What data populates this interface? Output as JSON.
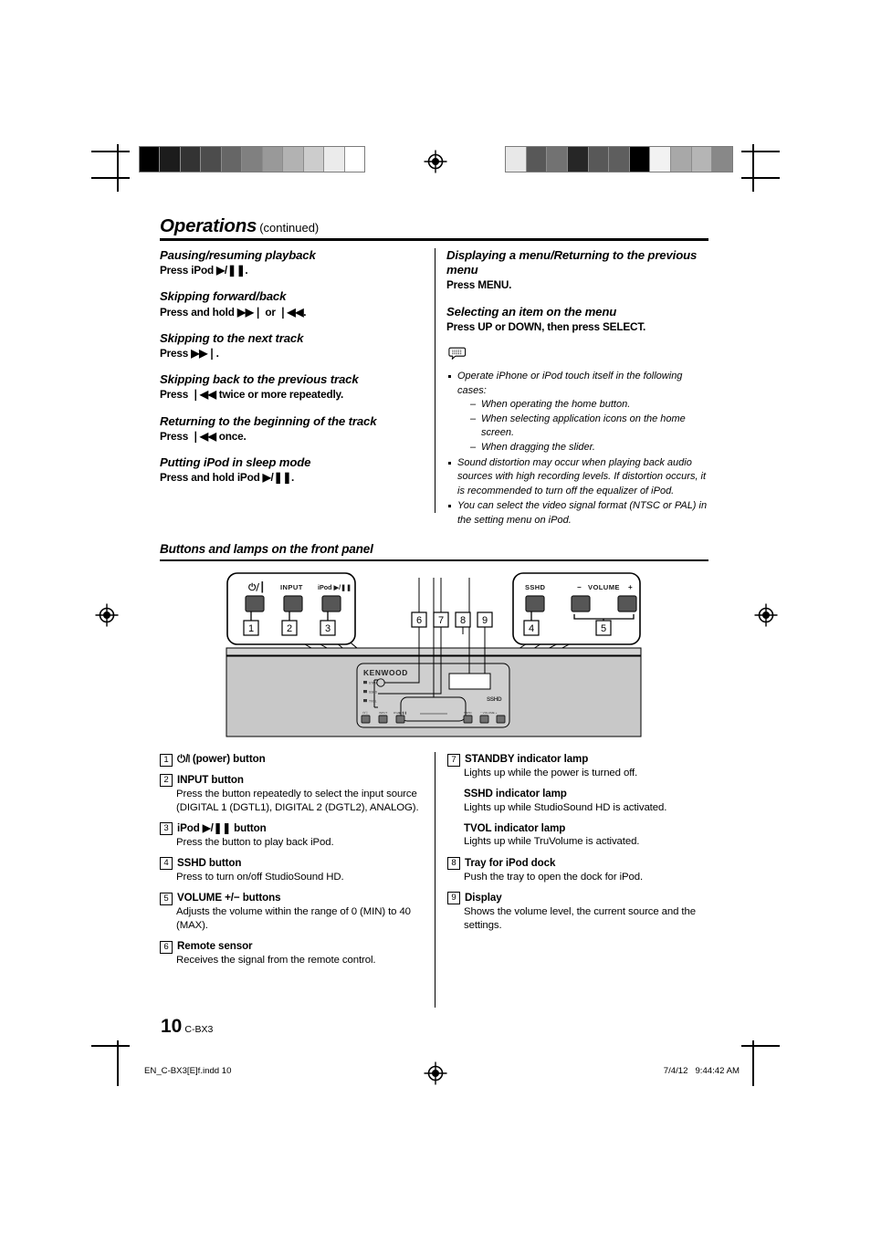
{
  "header": {
    "title": "Operations",
    "continued": "(continued)"
  },
  "left_column": [
    {
      "heading": "Pausing/resuming playback",
      "body": "Press iPod ▶/❚❚."
    },
    {
      "heading": "Skipping forward/back",
      "body": "Press and hold ▶▶❘ or ❘◀◀."
    },
    {
      "heading": "Skipping to the next track",
      "body": "Press ▶▶❘."
    },
    {
      "heading": "Skipping back to the previous track",
      "body": "Press ❘◀◀ twice or more repeatedly."
    },
    {
      "heading": "Returning to the beginning of the track",
      "body": "Press ❘◀◀ once."
    },
    {
      "heading": "Putting iPod in sleep mode",
      "body": "Press and hold iPod ▶/❚❚."
    }
  ],
  "right_column": [
    {
      "heading": "Displaying a menu/Returning to the previous menu",
      "body": "Press MENU."
    },
    {
      "heading": "Selecting an item on the menu",
      "body": "Press UP or DOWN, then press SELECT."
    }
  ],
  "notes": {
    "icon": "note-bubble-icon",
    "items": [
      {
        "text": "Operate iPhone or iPod touch itself in the following cases:",
        "subitems": [
          "When operating the home button.",
          "When selecting application icons on the home screen.",
          "When dragging the slider."
        ]
      },
      {
        "text": "Sound distortion may occur when playing back audio sources with high recording levels. If distortion occurs, it is recommended to turn off the equalizer of iPod.",
        "subitems": []
      },
      {
        "text": "You can select the video signal format (NTSC or PAL) in the setting menu on iPod.",
        "subitems": []
      }
    ]
  },
  "section2": {
    "title": "Buttons and lamps on the front panel"
  },
  "figure": {
    "brand": "KENWOOD",
    "left_callout": {
      "buttons": [
        {
          "label": "⏻/❘",
          "number": "1"
        },
        {
          "label": "INPUT",
          "number": "2"
        },
        {
          "label": "iPod ▶/❚❚",
          "number": "3"
        }
      ]
    },
    "right_callout": {
      "sshd_label": "SSHD",
      "sshd_number": "4",
      "volume_minus": "−",
      "volume_label": "VOLUME",
      "volume_plus": "+",
      "volume_number": "5"
    },
    "center_numbers": [
      "6",
      "7",
      "8",
      "9"
    ],
    "sshd_logo": "SSHD"
  },
  "descriptions_left": [
    {
      "number": "1",
      "title": "⏻/❘ (power) button",
      "body": ""
    },
    {
      "number": "2",
      "title": "INPUT button",
      "body": "Press the button repeatedly to select the input source (DIGITAL 1 (DGTL1), DIGITAL 2 (DGTL2), ANALOG)."
    },
    {
      "number": "3",
      "title": "iPod ▶/❚❚ button",
      "body": "Press the button to play back iPod."
    },
    {
      "number": "4",
      "title": "SSHD button",
      "body": "Press to turn on/off StudioSound HD."
    },
    {
      "number": "5",
      "title": "VOLUME +/− buttons",
      "body": "Adjusts the volume within the range of 0 (MIN) to 40 (MAX)."
    },
    {
      "number": "6",
      "title": "Remote sensor",
      "body": "Receives the signal from the remote control."
    }
  ],
  "descriptions_right": [
    {
      "number": "7",
      "title": "STANDBY indicator lamp",
      "body": "Lights up while the power is turned off.",
      "sublamps": [
        {
          "title": "SSHD indicator lamp",
          "body": "Lights up while StudioSound HD is activated."
        },
        {
          "title": "TVOL indicator lamp",
          "body": "Lights up while TruVolume is activated."
        }
      ]
    },
    {
      "number": "8",
      "title": "Tray for iPod dock",
      "body": "Push the tray to open the dock for iPod.",
      "sublamps": []
    },
    {
      "number": "9",
      "title": "Display",
      "body": "Shows the volume level, the current source and the settings.",
      "sublamps": []
    }
  ],
  "page": {
    "number": "10",
    "model": "C-BX3"
  },
  "footer": {
    "filename": "EN_C-BX3[E]f.indd   10",
    "timestamp": "7/4/12   9:44:42 AM"
  },
  "calibration": {
    "left_strip": [
      "#000000",
      "#1c1c1c",
      "#333333",
      "#4c4c4c",
      "#666666",
      "#808080",
      "#999999",
      "#b2b2b2",
      "#cccccc",
      "#ebebeb",
      "#ffffff"
    ],
    "right_strip": [
      "#e8e8e8",
      "#585858",
      "#727272",
      "#262626",
      "#585858",
      "#5e5e5e",
      "#000000",
      "#f2f2f2",
      "#a8a8a8",
      "#b5b5b5",
      "#888888"
    ]
  }
}
